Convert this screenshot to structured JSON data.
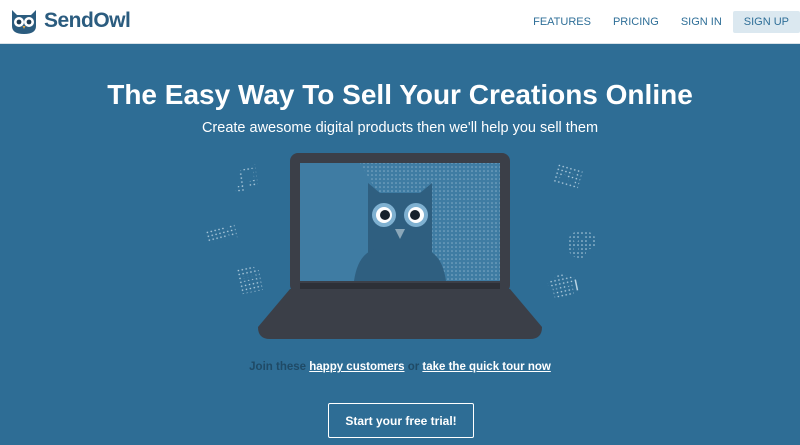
{
  "brand": {
    "name": "SendOwl",
    "logo_icon": "owl-logo-icon"
  },
  "nav": {
    "items": [
      {
        "label": "FEATURES"
      },
      {
        "label": "PRICING"
      },
      {
        "label": "SIGN IN"
      },
      {
        "label": "SIGN UP"
      }
    ]
  },
  "hero": {
    "title": "The Easy Way To Sell Your Creations Online",
    "subtitle": "Create awesome digital products then we'll help you sell them",
    "illustration_icons": [
      "music-icon",
      "video-camera-icon",
      "document-icon",
      "image-icon",
      "palette-icon",
      "mortarboard-icon",
      "laptop-icon",
      "owl-icon"
    ]
  },
  "cta": {
    "prefix": "Join these",
    "customers_link": "happy customers",
    "or": "or",
    "tour_link": "take the quick tour now",
    "button_label": "Start your free trial!"
  },
  "colors": {
    "background": "#2e6d95",
    "header": "#ffffff",
    "nav_text": "#2f6f98",
    "signup_bg": "#dbe8f0",
    "laptop": "#3b3f48"
  }
}
